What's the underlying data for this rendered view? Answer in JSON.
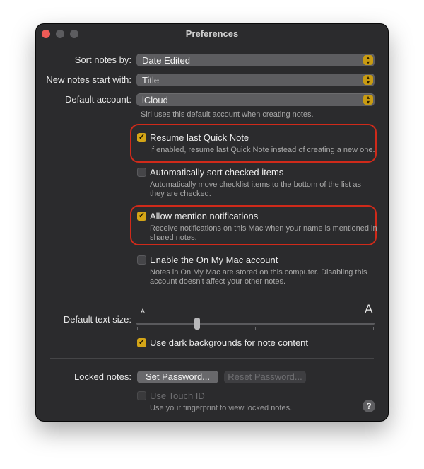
{
  "window": {
    "title": "Preferences"
  },
  "sort": {
    "label": "Sort notes by:",
    "value": "Date Edited"
  },
  "new_notes": {
    "label": "New notes start with:",
    "value": "Title"
  },
  "account": {
    "label": "Default account:",
    "value": "iCloud",
    "note": "Siri uses this default account when creating notes."
  },
  "options": [
    {
      "label": "Resume last Quick Note",
      "checked": true,
      "desc": [
        "If enabled, resume last Quick Note instead of creating a new one."
      ]
    },
    {
      "label": "Automatically sort checked items",
      "checked": false,
      "desc": [
        "Automatically move checklist items to the bottom of the list as",
        "they are checked."
      ]
    },
    {
      "label": "Allow mention notifications",
      "checked": true,
      "desc": [
        "Receive notifications on this Mac when your name is mentioned in",
        "shared notes."
      ]
    },
    {
      "label": "Enable the On My Mac account",
      "checked": false,
      "desc": [
        "Notes in On My Mac are stored on this computer. Disabling this",
        "account doesn't affect your other notes."
      ]
    }
  ],
  "text_size": {
    "label": "Default text size:",
    "small": "A",
    "large": "A",
    "level": 0.25
  },
  "dark_bg": {
    "label": "Use dark backgrounds for note content",
    "checked": true
  },
  "locked": {
    "label": "Locked notes:",
    "set_password": "Set Password...",
    "reset_password": "Reset Password..."
  },
  "touch_id": {
    "label": "Use Touch ID",
    "desc": "Use your fingerprint to view locked notes."
  },
  "help": "?",
  "glyphs": {
    "check": "✓",
    "stepper_up": "▴",
    "stepper_down": "▾"
  },
  "colors": {
    "accent": "#d4a517",
    "highlight": "#d02a1a"
  }
}
